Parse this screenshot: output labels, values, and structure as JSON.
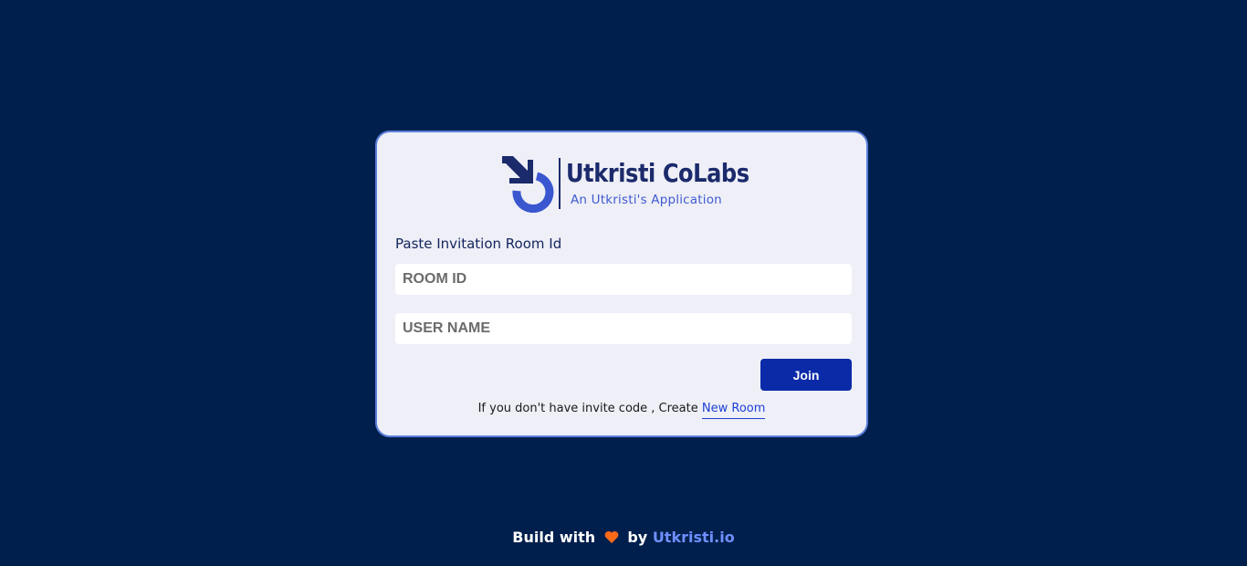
{
  "logo": {
    "title": "Utkristi CoLabs",
    "subtitle": "An Utkristi's Application",
    "icon": "colabs-logo-icon"
  },
  "form": {
    "section_label": "Paste Invitation Room Id",
    "room_id_placeholder": "ROOM ID",
    "room_id_value": "",
    "username_placeholder": "USER NAME",
    "username_value": "",
    "join_label": "Join"
  },
  "invite": {
    "text": "If you don't have invite code , Create ",
    "link_label": "New Room"
  },
  "footer": {
    "prefix": "Build with",
    "icon": "heart-icon",
    "by": "by",
    "link_label": "Utkristi.io"
  },
  "colors": {
    "background": "#001f4c",
    "card": "#eeeff7",
    "card_border": "#5b7fdc",
    "primary_button": "#0a2aa8",
    "link": "#1d3fd6",
    "heart": "#ff6a1a"
  }
}
